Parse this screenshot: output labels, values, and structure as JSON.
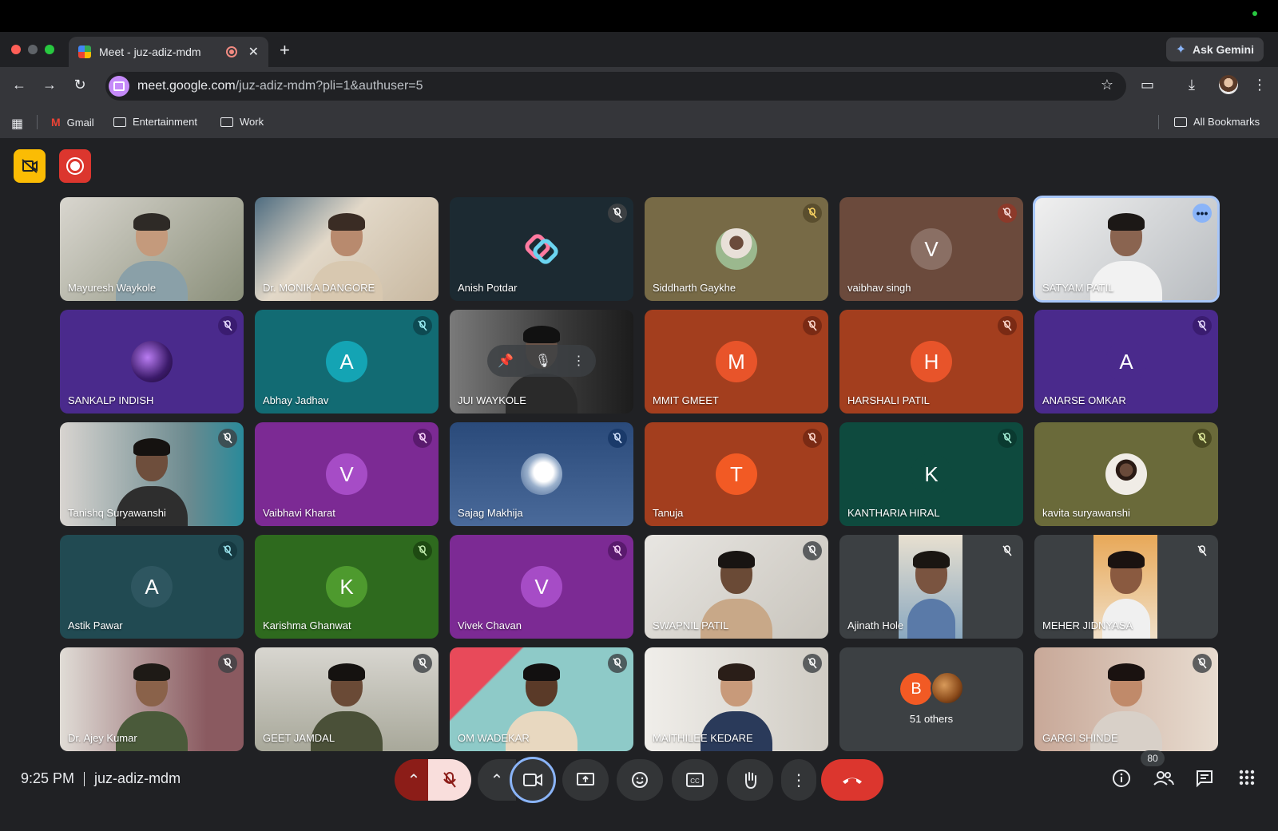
{
  "browser": {
    "tab_title": "Meet - juz-adiz-mdm",
    "tab_close": "✕",
    "new_tab": "+",
    "ask_gemini": "Ask Gemini",
    "url_host": "meet.google.com",
    "url_path": "/juz-adiz-mdm?pli=1&authuser=5",
    "bookmarks": [
      "Gmail",
      "Entertainment",
      "Work"
    ],
    "all_bookmarks": "All Bookmarks"
  },
  "meeting": {
    "time": "9:25 PM",
    "code": "juz-adiz-mdm",
    "participant_count": "80",
    "others_label": "51 others",
    "others_initial": "B"
  },
  "tiles": [
    {
      "name": "Mayuresh Waykole"
    },
    {
      "name": "Dr. MONIKA DANGORE"
    },
    {
      "name": "Anish Potdar"
    },
    {
      "name": "Siddharth Gaykhe"
    },
    {
      "name": "vaibhav singh",
      "initial": "V"
    },
    {
      "name": "SATYAM PATIL"
    },
    {
      "name": "SANKALP INDISH"
    },
    {
      "name": "Abhay Jadhav",
      "initial": "A"
    },
    {
      "name": "JUI WAYKOLE"
    },
    {
      "name": "MMIT GMEET",
      "initial": "M"
    },
    {
      "name": "HARSHALI PATIL",
      "initial": "H"
    },
    {
      "name": "ANARSE OMKAR",
      "initial": "A"
    },
    {
      "name": "Tanishq Suryawanshi"
    },
    {
      "name": "Vaibhavi Kharat",
      "initial": "V"
    },
    {
      "name": "Sajag Makhija"
    },
    {
      "name": "Tanuja",
      "initial": "T"
    },
    {
      "name": "KANTHARIA HIRAL",
      "initial": "K"
    },
    {
      "name": "kavita suryawanshi"
    },
    {
      "name": "Astik Pawar",
      "initial": "A"
    },
    {
      "name": "Karishma Ghanwat",
      "initial": "K"
    },
    {
      "name": "Vivek Chavan",
      "initial": "V"
    },
    {
      "name": "SWAPNIL PATIL"
    },
    {
      "name": "Ajinath Hole"
    },
    {
      "name": "MEHER JIDNYASA"
    },
    {
      "name": "Dr. Ajey Kumar"
    },
    {
      "name": "GEET JAMDAL"
    },
    {
      "name": "OM WADEKAR"
    },
    {
      "name": "MAITHILEE KEDARE"
    },
    {
      "name": "GARGI SHINDE"
    }
  ],
  "colors": {
    "accent_blue": "#8ab4f8",
    "leave_red": "#ea4335",
    "mic_off_bg": "#f9dedc",
    "record_red": "#dc362e",
    "no_video_yellow": "#fbbc04"
  },
  "icons": {
    "mic_off": "muted-microphone-icon",
    "camera": "video-camera-icon",
    "present": "present-screen-icon",
    "emoji": "emoji-icon",
    "captions": "closed-captions-icon",
    "hand": "raise-hand-icon",
    "more": "more-options-icon",
    "leave": "hang-up-icon",
    "info": "meeting-info-icon",
    "people": "people-icon",
    "chat": "chat-icon",
    "activities": "activities-grid-icon"
  }
}
